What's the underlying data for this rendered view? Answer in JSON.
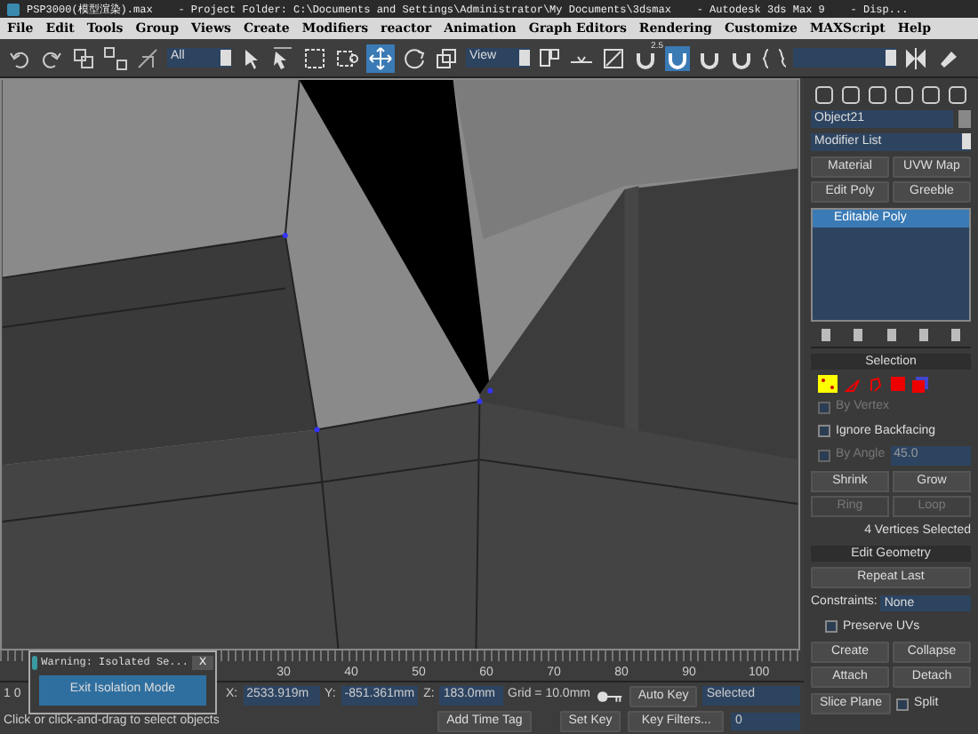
{
  "window": {
    "title": "PSP3000(模型渲染).max    - Project Folder: C:\\Documents and Settings\\Administrator\\My Documents\\3dsmax    - Autodesk 3ds Max 9    - Disp..."
  },
  "menu": [
    "File",
    "Edit",
    "Tools",
    "Group",
    "Views",
    "Create",
    "Modifiers",
    "reactor",
    "Animation",
    "Graph Editors",
    "Rendering",
    "Customize",
    "MAXScript",
    "Help"
  ],
  "toolbar": {
    "selection_filter": "All",
    "reference_coord": "View",
    "snap_label": "2.5"
  },
  "command_panel": {
    "object_name": "Object21",
    "modifier_list": "Modifier List",
    "modifier_buttons": [
      "Material",
      "UVW Map",
      "Edit Poly",
      "Greeble"
    ],
    "stack": [
      {
        "label": "Editable Poly",
        "selected": true
      }
    ],
    "selection": {
      "title": "Selection",
      "by_vertex": {
        "label": "By Vertex",
        "checked": false,
        "disabled": true
      },
      "ignore_backfacing": {
        "label": "Ignore Backfacing",
        "checked": false,
        "disabled": false
      },
      "by_angle": {
        "label": "By Angle",
        "value": "45.0",
        "checked": false,
        "disabled": true
      },
      "buttons": [
        {
          "label": "Shrink",
          "disabled": false
        },
        {
          "label": "Grow",
          "disabled": false
        },
        {
          "label": "Ring",
          "disabled": true
        },
        {
          "label": "Loop",
          "disabled": true
        }
      ],
      "status": "4 Vertices Selected"
    },
    "edit_geometry": {
      "title": "Edit Geometry",
      "repeat_last": "Repeat Last",
      "constraints_label": "Constraints:",
      "constraints_value": "None",
      "preserve_uvs": {
        "label": "Preserve UVs",
        "checked": false
      },
      "buttons": [
        "Create",
        "Collapse",
        "Attach",
        "Detach"
      ],
      "slice_plane": "Slice Plane",
      "split": {
        "label": "Split",
        "checked": false
      }
    }
  },
  "timeline": {
    "ticks": [
      "30",
      "40",
      "50",
      "60",
      "70",
      "80",
      "90",
      "100"
    ]
  },
  "warning_dialog": {
    "title": "Warning: Isolated Se...",
    "close": "X",
    "button": "Exit Isolation Mode"
  },
  "status_bar": {
    "frame_counter": "1 0",
    "x_label": "X:",
    "x": "2533.919m",
    "y_label": "Y:",
    "y": "-851.361mm",
    "z_label": "Z:",
    "z": "183.0mm",
    "grid": "Grid = 10.0mm",
    "auto_key": "Auto Key",
    "key_mode": "Selected",
    "set_key": "Set Key",
    "key_filters": "Key Filters...",
    "current_frame": "0",
    "prompt": "Click or click-and-drag to select objects",
    "add_time_tag": "Add Time Tag"
  }
}
